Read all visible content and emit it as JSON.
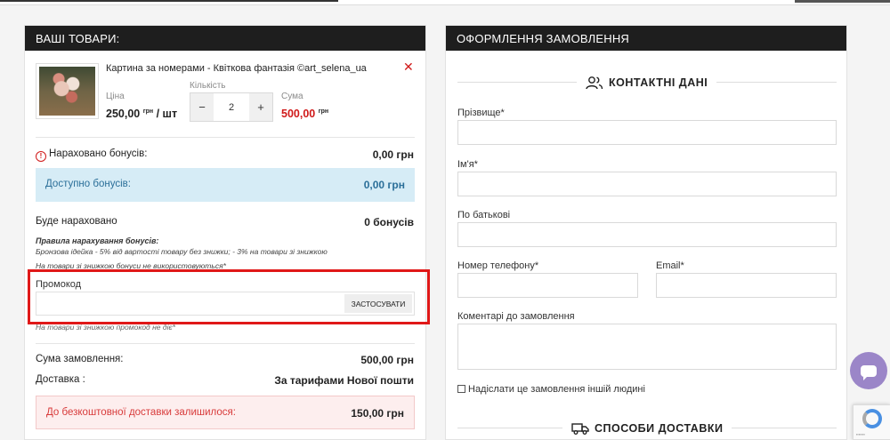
{
  "left_panel": {
    "title": "ВАШІ ТОВАРИ:",
    "product": {
      "name": "Картина за номерами - Квіткова фантазія ©art_selena_ua",
      "price_label": "Ціна",
      "price_value": "250,00",
      "price_unit": "грн",
      "price_per": " / шт",
      "qty_label": "Кількість",
      "qty_value": "2",
      "qty_minus": "−",
      "qty_plus": "+",
      "sum_label": "Сума",
      "sum_value": "500,00",
      "sum_unit": "грн",
      "remove_symbol": "✕"
    },
    "bonuses": {
      "accrued_label": "Нараховано бонусів:",
      "accrued_value": "0,00 грн",
      "available_label": "Доступно бонусів:",
      "available_value": "0,00 грн",
      "will_accrue_label": "Буде нараховано",
      "will_accrue_value": "0 бонусів",
      "rules_title": "Правила нарахування бонусів:",
      "rules_text": "Бронзова ідейка - 5% від вартості товару без знижки; - 3% на товари зі знижкою",
      "rules_note": "На товари зі знижкою бонуси не використовуються*"
    },
    "promo": {
      "label": "Промокод",
      "placeholder": "",
      "button": "ЗАСТОСУВАТИ",
      "note": "На товари зі знижкою промокод не діє*"
    },
    "totals": {
      "order_sum_label": "Сума замовлення:",
      "order_sum_value": "500,00 грн",
      "delivery_label": "Доставка :",
      "delivery_value": "За тарифами Нової пошти",
      "free_delivery_label": "До безкоштовної доставки залишилося:",
      "free_delivery_value": "150,00 грн"
    }
  },
  "right_panel": {
    "title": "ОФОРМЛЕННЯ ЗАМОВЛЕННЯ",
    "contact_section": "КОНТАКТНІ ДАНІ",
    "fields": {
      "surname": "Прізвище*",
      "name": "Ім'я*",
      "patronymic": "По батькові",
      "phone": "Номер телефону*",
      "email": "Email*",
      "comment": "Коментарі до замовлення"
    },
    "other_person": "Надіслати це замовлення іншій людині",
    "delivery_section": "СПОСОБИ ДОСТАВКИ"
  },
  "icons": {
    "contact": "users-icon",
    "delivery": "truck-icon",
    "chat": "chat-icon",
    "info": "info-icon",
    "remove": "close-icon"
  },
  "colors": {
    "header_bg": "#1e1e1e",
    "accent_red": "#d01a1a",
    "bonus_box": "#d6ecf6",
    "delivery_box": "#fdeeee",
    "chat_button": "#9b86c8"
  }
}
